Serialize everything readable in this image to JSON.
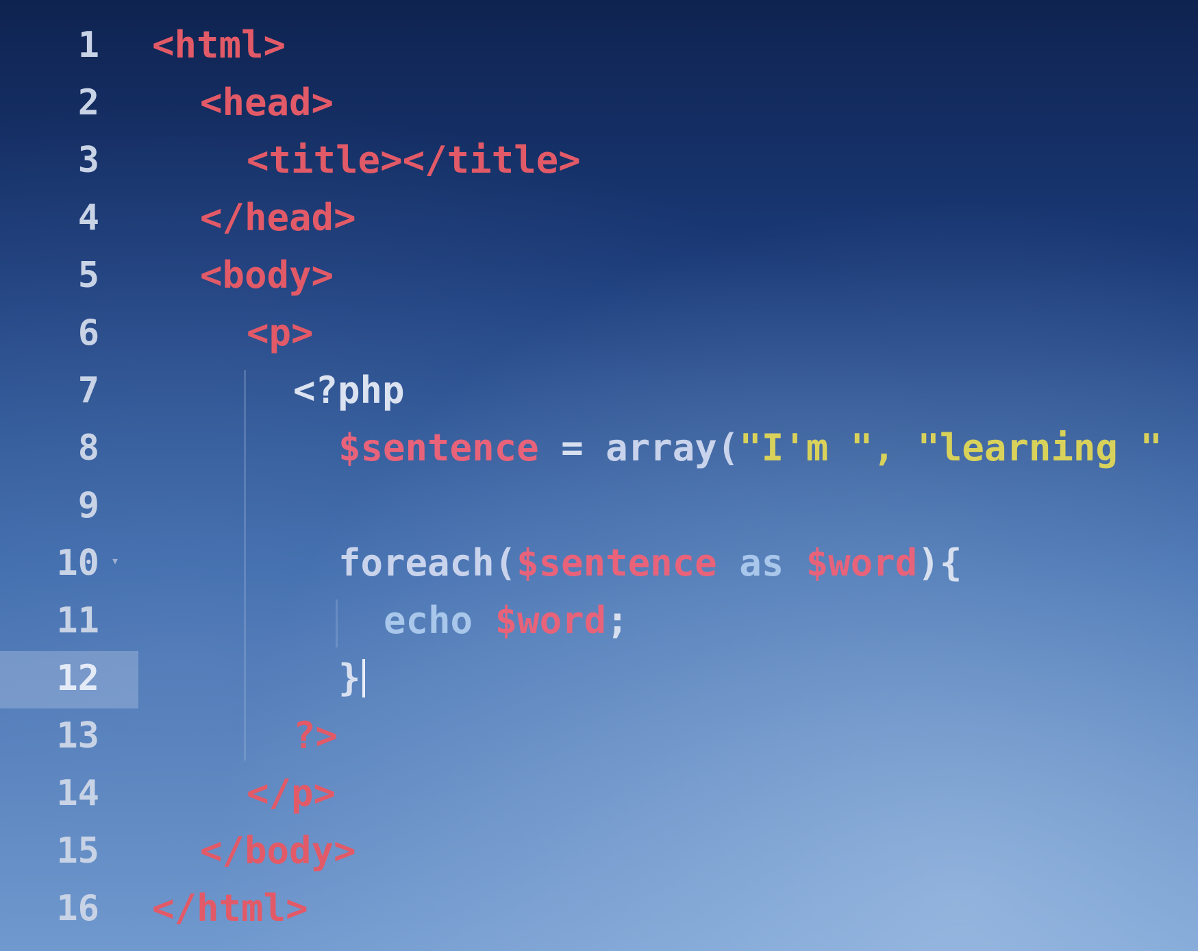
{
  "editor": {
    "active_line": 12,
    "lines": [
      {
        "num": "1",
        "tokens": [
          "<html>"
        ]
      },
      {
        "num": "2",
        "tokens": [
          "<head>"
        ]
      },
      {
        "num": "3",
        "tokens": [
          "<title></title>"
        ]
      },
      {
        "num": "4",
        "tokens": [
          "</head>"
        ]
      },
      {
        "num": "5",
        "tokens": [
          "<body>"
        ]
      },
      {
        "num": "6",
        "tokens": [
          "<p>"
        ]
      },
      {
        "num": "7",
        "tokens": [
          "<?php"
        ]
      },
      {
        "num": "8",
        "tokens": [
          "$sentence",
          " = ",
          "array(",
          "\"I'm \", \"learning \""
        ]
      },
      {
        "num": "9",
        "tokens": []
      },
      {
        "num": "10",
        "tokens": [
          "foreach(",
          "$sentence",
          " as ",
          "$word",
          "){"
        ]
      },
      {
        "num": "11",
        "tokens": [
          "echo ",
          "$word",
          ";"
        ]
      },
      {
        "num": "12",
        "tokens": [
          "}"
        ]
      },
      {
        "num": "13",
        "tokens": [
          "?>"
        ]
      },
      {
        "num": "14",
        "tokens": [
          "</p>"
        ]
      },
      {
        "num": "15",
        "tokens": [
          "</body>"
        ]
      },
      {
        "num": "16",
        "tokens": [
          "</html>"
        ]
      }
    ]
  },
  "colors": {
    "tag": "#e25a67",
    "variable": "#e8637a",
    "string": "#d9d25a",
    "keyword": "#a8c7ea",
    "default": "#dbe2f0",
    "line_number": "#c9d3e6",
    "active_line_gutter": "#96afd7"
  },
  "icons": {
    "fold": "chevron-down-icon"
  }
}
